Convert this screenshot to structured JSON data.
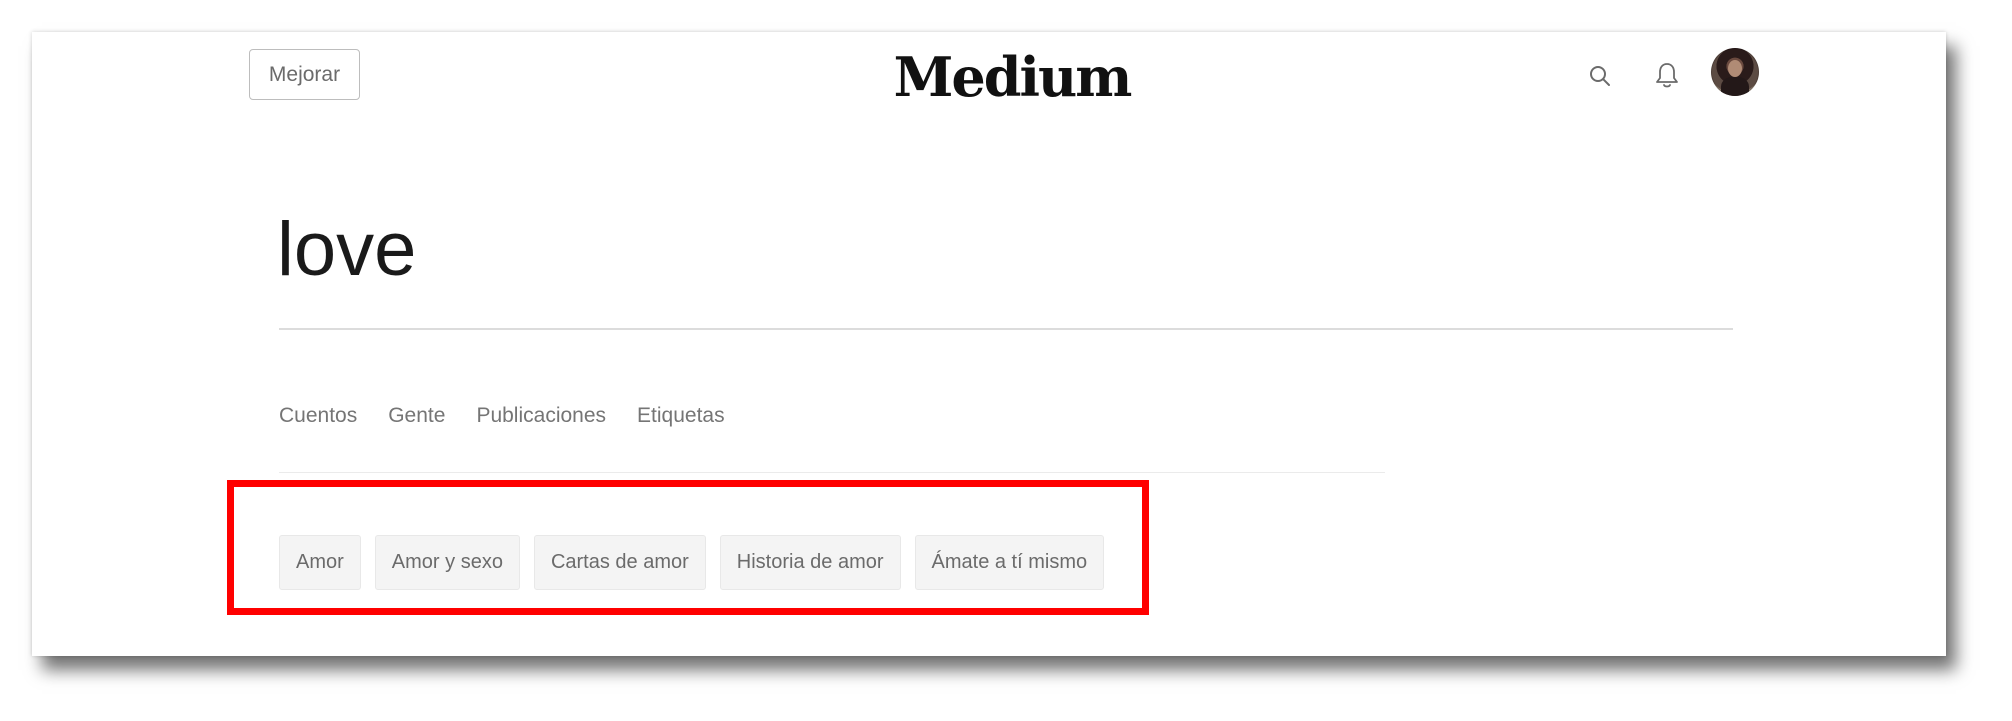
{
  "header": {
    "upgrade_label": "Mejorar",
    "logo_text": "Medium",
    "icons": [
      "search-icon",
      "bell-icon"
    ]
  },
  "search_results": {
    "query_title": "love",
    "tabs": [
      {
        "label": "Cuentos"
      },
      {
        "label": "Gente"
      },
      {
        "label": "Publicaciones"
      },
      {
        "label": "Etiquetas"
      }
    ],
    "tags": [
      {
        "label": "Amor"
      },
      {
        "label": "Amor y sexo"
      },
      {
        "label": "Cartas de amor"
      },
      {
        "label": "Historia de amor"
      },
      {
        "label": "Ámate a tí mismo"
      }
    ]
  },
  "colors": {
    "highlight": "#ff0000",
    "chip_background": "#f4f4f4",
    "muted_text": "#757575"
  }
}
